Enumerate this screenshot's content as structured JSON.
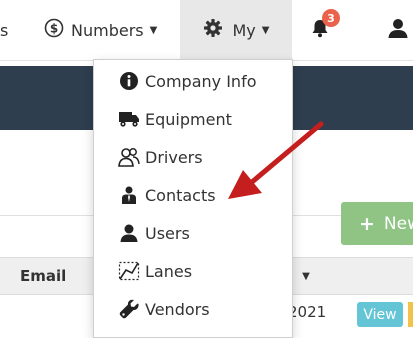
{
  "nav": {
    "left_fragment": "s",
    "numbers_label": "Numbers",
    "my_label": "My",
    "notification_count": "3"
  },
  "menu": {
    "items": [
      {
        "label": "Company Info",
        "icon": "info-circle-icon"
      },
      {
        "label": "Equipment",
        "icon": "truck-icon"
      },
      {
        "label": "Drivers",
        "icon": "drivers-icon"
      },
      {
        "label": "Contacts",
        "icon": "contact-icon"
      },
      {
        "label": "Users",
        "icon": "user-icon"
      },
      {
        "label": "Lanes",
        "icon": "lanes-icon"
      },
      {
        "label": "Vendors",
        "icon": "wrench-icon"
      }
    ]
  },
  "toolbar": {
    "new_label": "New"
  },
  "table": {
    "headers": {
      "email": "Email",
      "date": "ted"
    },
    "row": {
      "date_text": "2021",
      "view_label": "View"
    }
  },
  "colors": {
    "nav_active_bg": "#e8e8e8",
    "dark_bar": "#2e3e4e",
    "new_button": "#8fc484",
    "view_button": "#63c5d6",
    "badge": "#e8624c",
    "annotation_arrow": "#c41e1e"
  }
}
